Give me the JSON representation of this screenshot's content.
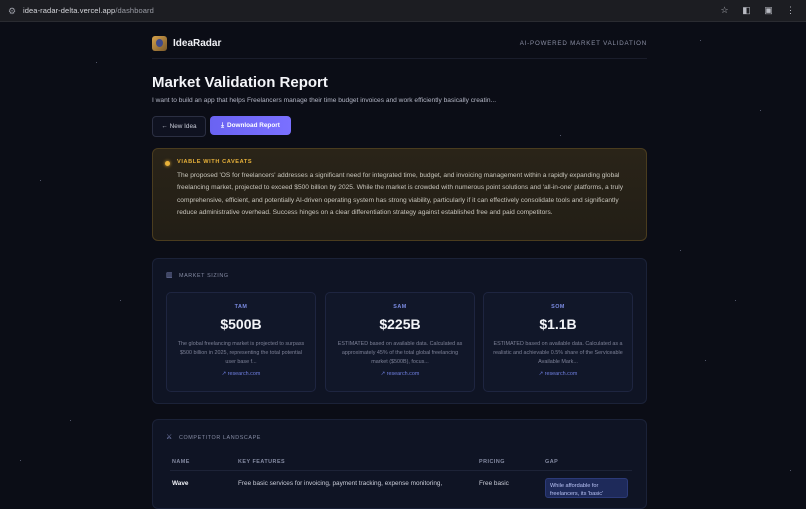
{
  "browser": {
    "url_host": "idea-radar-delta.vercel.app",
    "url_path": "/dashboard"
  },
  "header": {
    "brand": "IdeaRadar",
    "tagline": "AI-POWERED MARKET VALIDATION"
  },
  "report": {
    "title": "Market Validation Report",
    "idea": "I want to build an app that helps Freelancers manage their time budget invoices and work efficiently basically creatin..."
  },
  "actions": {
    "new_idea": "← New Idea",
    "download": "Download Report"
  },
  "verdict": {
    "label": "VIABLE WITH CAVEATS",
    "color": "#e8b23a",
    "summary": "The proposed 'OS for freelancers' addresses a significant need for integrated time, budget, and invoicing management within a rapidly expanding global freelancing market, projected to exceed $500 billion by 2025. While the market is crowded with numerous point solutions and 'all-in-one' platforms, a truly comprehensive, efficient, and potentially AI-driven operating system has strong viability, particularly if it can effectively consolidate tools and significantly reduce administrative overhead. Success hinges on a clear differentiation strategy against established free and paid competitors."
  },
  "market_sizing": {
    "heading": "MARKET SIZING",
    "tam": {
      "label": "TAM",
      "value": "$500B",
      "desc": "The global freelancing market is projected to surpass $500 billion in 2025, representing the total potential user base f...",
      "source": "↗ research.com"
    },
    "sam": {
      "label": "SAM",
      "value": "$225B",
      "desc": "ESTIMATED based on available data. Calculated as approximately 45% of the total global freelancing market ($500B), focus...",
      "source": "↗ research.com"
    },
    "som": {
      "label": "SOM",
      "value": "$1.1B",
      "desc": "ESTIMATED based on available data. Calculated as a realistic and achievable 0.5% share of the Serviceable Available Mark...",
      "source": "↗ research.com"
    }
  },
  "competitors": {
    "heading": "COMPETITOR LANDSCAPE",
    "columns": [
      "NAME",
      "KEY FEATURES",
      "PRICING",
      "GAP"
    ],
    "rows": [
      {
        "name": "Wave",
        "features": "Free basic services for invoicing, payment tracking, expense monitoring,",
        "pricing": "Free basic",
        "gap": "While affordable for freelancers, its 'basic'"
      }
    ]
  }
}
